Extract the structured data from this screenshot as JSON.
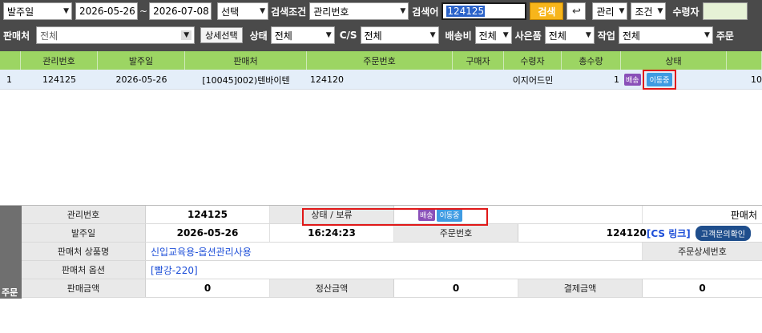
{
  "filters": {
    "date_type": "발주일",
    "date_from": "2026-05-26",
    "tilde": "~",
    "date_to": "2026-07-08",
    "select_placeholder": "선택",
    "search_condition_label": "검색조건",
    "search_condition_value": "관리번호",
    "search_word_label": "검색어",
    "search_word_value": "124125",
    "search_button": "검색",
    "reset_icon": "undo-icon",
    "manage_label": "관리",
    "condition_label": "조건",
    "recipient_label": "수령자",
    "seller_label": "판매처",
    "seller_value": "전체",
    "detail_select_button": "상세선택",
    "status_label": "상태",
    "status_value": "전체",
    "cs_label": "C/S",
    "cs_value": "전체",
    "shipping_fee_label": "배송비",
    "shipping_fee_value": "전체",
    "gift_label": "사은품",
    "gift_value": "전체",
    "work_label": "작업",
    "work_value": "전체",
    "order_label_cut": "주문"
  },
  "grid": {
    "columns": [
      "",
      "관리번호",
      "발주일",
      "판매처",
      "주문번호",
      "구매자",
      "수령자",
      "총수량",
      "상태",
      ""
    ],
    "rows": [
      {
        "index": "1",
        "manage_no": "124125",
        "order_date": "2026-05-26",
        "seller": "[10045]002)텐바이텐",
        "order_no": "124120",
        "buyer": "",
        "recipient": "이지어드민",
        "total_qty": "1",
        "ship_badge": "배송",
        "status_badge": "이동중",
        "extra": "10"
      }
    ]
  },
  "detail": {
    "side_label": "주문",
    "manage_no_label": "관리번호",
    "manage_no": "124125",
    "status_label": "상태 / 보류",
    "ship_badge": "배송",
    "status_badge": "이동중",
    "seller_label": "판매처",
    "order_date_label": "발주일",
    "order_date": "2026-05-26",
    "order_time": "16:24:23",
    "order_no_label": "주문번호",
    "order_no": "124120",
    "cs_link": "[CS 링크]",
    "cs_button": "고객문의확인",
    "product_name_label": "판매처 상품명",
    "product_name": "신입교육용-옵션관리사용",
    "order_detail_no_label": "주문상세번호",
    "option_label": "판매처 옵션",
    "option_value": "[빨강-220]",
    "sale_amount_label": "판매금액",
    "sale_amount": "0",
    "settle_amount_label": "정산금액",
    "settle_amount": "0",
    "pay_amount_label": "결제금액",
    "pay_amount": "0"
  }
}
